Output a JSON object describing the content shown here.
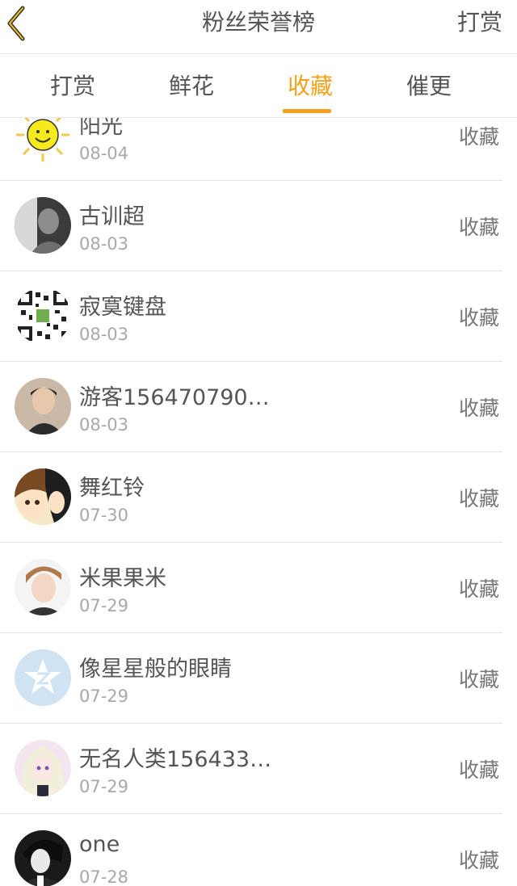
{
  "header": {
    "title": "粉丝荣誉榜",
    "action_label": "打赏"
  },
  "tabs": [
    {
      "label": "打赏",
      "active": false
    },
    {
      "label": "鲜花",
      "active": false
    },
    {
      "label": "收藏",
      "active": true
    },
    {
      "label": "催更",
      "active": false
    }
  ],
  "colors": {
    "accent": "#f3a21b",
    "text": "#555555",
    "muted": "#a8a8a8"
  },
  "list": [
    {
      "name": "阳光",
      "date": "08-04",
      "action": "收藏",
      "avatar": "sun-avatar"
    },
    {
      "name": "古训超",
      "date": "08-03",
      "action": "收藏",
      "avatar": "photo-avatar"
    },
    {
      "name": "寂寞键盘",
      "date": "08-03",
      "action": "收藏",
      "avatar": "qr-avatar"
    },
    {
      "name": "游客156470790…",
      "date": "08-03",
      "action": "收藏",
      "avatar": "photo-avatar"
    },
    {
      "name": "舞红铃",
      "date": "07-30",
      "action": "收藏",
      "avatar": "anime-avatar"
    },
    {
      "name": "米果果米",
      "date": "07-29",
      "action": "收藏",
      "avatar": "photo-avatar"
    },
    {
      "name": "像星星般的眼睛",
      "date": "07-29",
      "action": "收藏",
      "avatar": "qq-default-avatar"
    },
    {
      "name": "无名人类156433…",
      "date": "07-29",
      "action": "收藏",
      "avatar": "anime-avatar"
    },
    {
      "name": "one",
      "date": "07-28",
      "action": "收藏",
      "avatar": "photo-avatar"
    }
  ]
}
